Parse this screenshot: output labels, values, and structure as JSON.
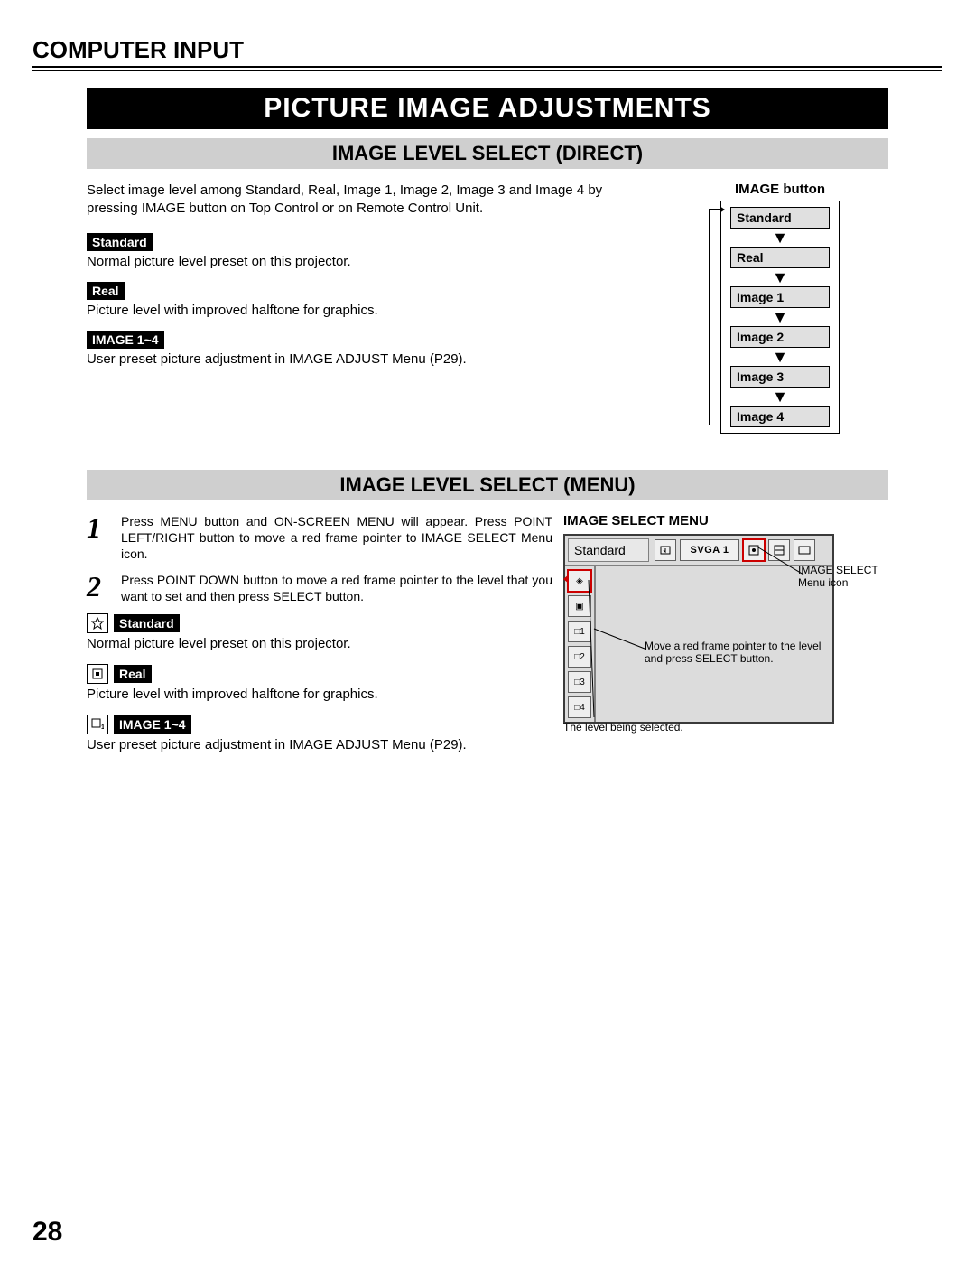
{
  "section_header": "COMPUTER INPUT",
  "title": "PICTURE IMAGE ADJUSTMENTS",
  "subheading_direct": "IMAGE LEVEL SELECT (DIRECT)",
  "direct": {
    "intro": "Select image level among Standard, Real, Image 1, Image 2, Image 3 and Image 4 by pressing IMAGE button on Top Control or on Remote Control Unit.",
    "standard_label": "Standard",
    "standard_desc": "Normal picture level preset on this projector.",
    "real_label": "Real",
    "real_desc": "Picture level with improved halftone for graphics.",
    "image14_label": "IMAGE 1~4",
    "image14_desc": "User preset picture adjustment in IMAGE ADJUST Menu (P29).",
    "flow_title": "IMAGE button",
    "flow_items": [
      "Standard",
      "Real",
      "Image 1",
      "Image 2",
      "Image 3",
      "Image 4"
    ]
  },
  "subheading_menu": "IMAGE LEVEL SELECT (MENU)",
  "menu": {
    "step1_num": "1",
    "step1_text": "Press MENU button and ON-SCREEN MENU will appear.  Press POINT LEFT/RIGHT button to move a red frame pointer to IMAGE SELECT Menu icon.",
    "step2_num": "2",
    "step2_text": "Press POINT DOWN button to move a red frame pointer to the level that you want to set and then press SELECT button.",
    "standard_label": "Standard",
    "standard_desc": "Normal picture level preset on this projector.",
    "real_label": "Real",
    "real_desc": "Picture level with improved halftone for graphics.",
    "image14_label": "IMAGE 1~4",
    "image14_desc": "User preset picture adjustment in IMAGE ADJUST Menu (P29).",
    "osd_title": "IMAGE SELECT MENU",
    "osd_name": "Standard",
    "osd_mode": "SVGA 1",
    "annot_icon": "IMAGE SELECT Menu icon",
    "annot_move": "Move a red frame pointer to the level and press SELECT button.",
    "annot_selected": "The level being selected.",
    "side_icons": [
      "◈",
      "▣",
      "□1",
      "□2",
      "□3",
      "□4"
    ]
  },
  "page_number": "28"
}
